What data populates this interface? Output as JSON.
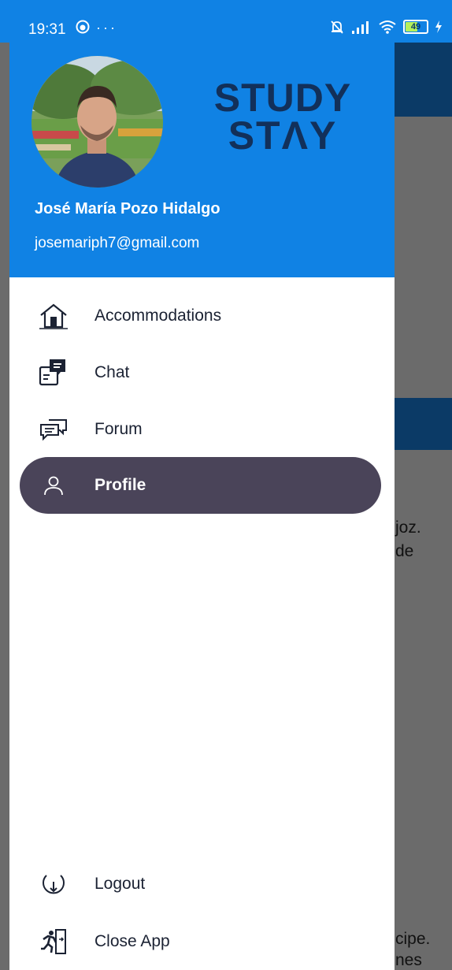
{
  "status_bar": {
    "time": "19:31",
    "battery": "49"
  },
  "background_text": [
    "joz.",
    "de",
    "cipe.",
    "nes"
  ],
  "drawer": {
    "header": {
      "logo_line1": "STUDY",
      "logo_line2": "STΛY",
      "user_name": "José María Pozo Hidalgo",
      "user_email": "josemariph7@gmail.com"
    },
    "menu": [
      {
        "label": "Accommodations",
        "icon": "house-icon"
      },
      {
        "label": "Chat",
        "icon": "chat-icon"
      },
      {
        "label": "Forum",
        "icon": "forum-icon"
      },
      {
        "label": "Profile",
        "icon": "person-icon",
        "active": true
      }
    ],
    "footer_menu": [
      {
        "label": "Logout",
        "icon": "logout-icon"
      },
      {
        "label": "Close App",
        "icon": "exit-running-icon"
      }
    ]
  },
  "colors": {
    "header_blue": "#1082e4",
    "active_pill": "#4a4459",
    "logo_navy": "#12305a"
  }
}
